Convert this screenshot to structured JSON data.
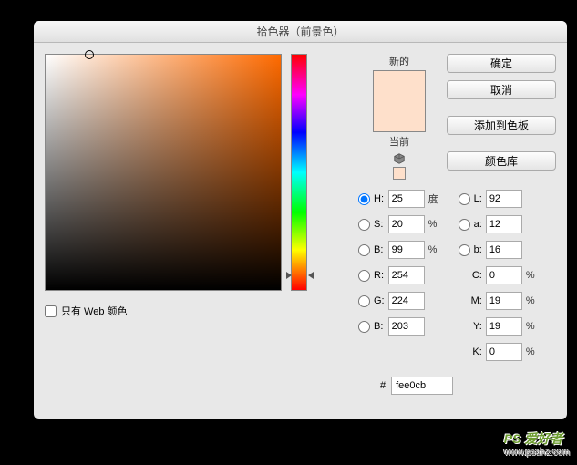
{
  "dialog": {
    "title": "拾色器（前景色）"
  },
  "buttons": {
    "ok": "确定",
    "cancel": "取消",
    "add_swatch": "添加到色板",
    "libraries": "颜色库"
  },
  "swatch": {
    "new_label": "新的",
    "current_label": "当前",
    "new_color": "#fee0cb",
    "current_color": "#fee0cb"
  },
  "web_only": {
    "label": "只有 Web 颜色",
    "checked": false
  },
  "fields": {
    "H": {
      "label": "H:",
      "value": "25",
      "unit": "度"
    },
    "S": {
      "label": "S:",
      "value": "20",
      "unit": "%"
    },
    "Bv": {
      "label": "B:",
      "value": "99",
      "unit": "%"
    },
    "L": {
      "label": "L:",
      "value": "92"
    },
    "a": {
      "label": "a:",
      "value": "12"
    },
    "b": {
      "label": "b:",
      "value": "16"
    },
    "R": {
      "label": "R:",
      "value": "254"
    },
    "G": {
      "label": "G:",
      "value": "224"
    },
    "Bc": {
      "label": "B:",
      "value": "203"
    },
    "C": {
      "label": "C:",
      "value": "0",
      "unit": "%"
    },
    "M": {
      "label": "M:",
      "value": "19",
      "unit": "%"
    },
    "Y": {
      "label": "Y:",
      "value": "19",
      "unit": "%"
    },
    "K": {
      "label": "K:",
      "value": "0",
      "unit": "%"
    }
  },
  "hex": {
    "label": "#",
    "value": "fee0cb"
  },
  "watermark": {
    "text": "PS 爱好者",
    "url": "www.psahz.com"
  }
}
